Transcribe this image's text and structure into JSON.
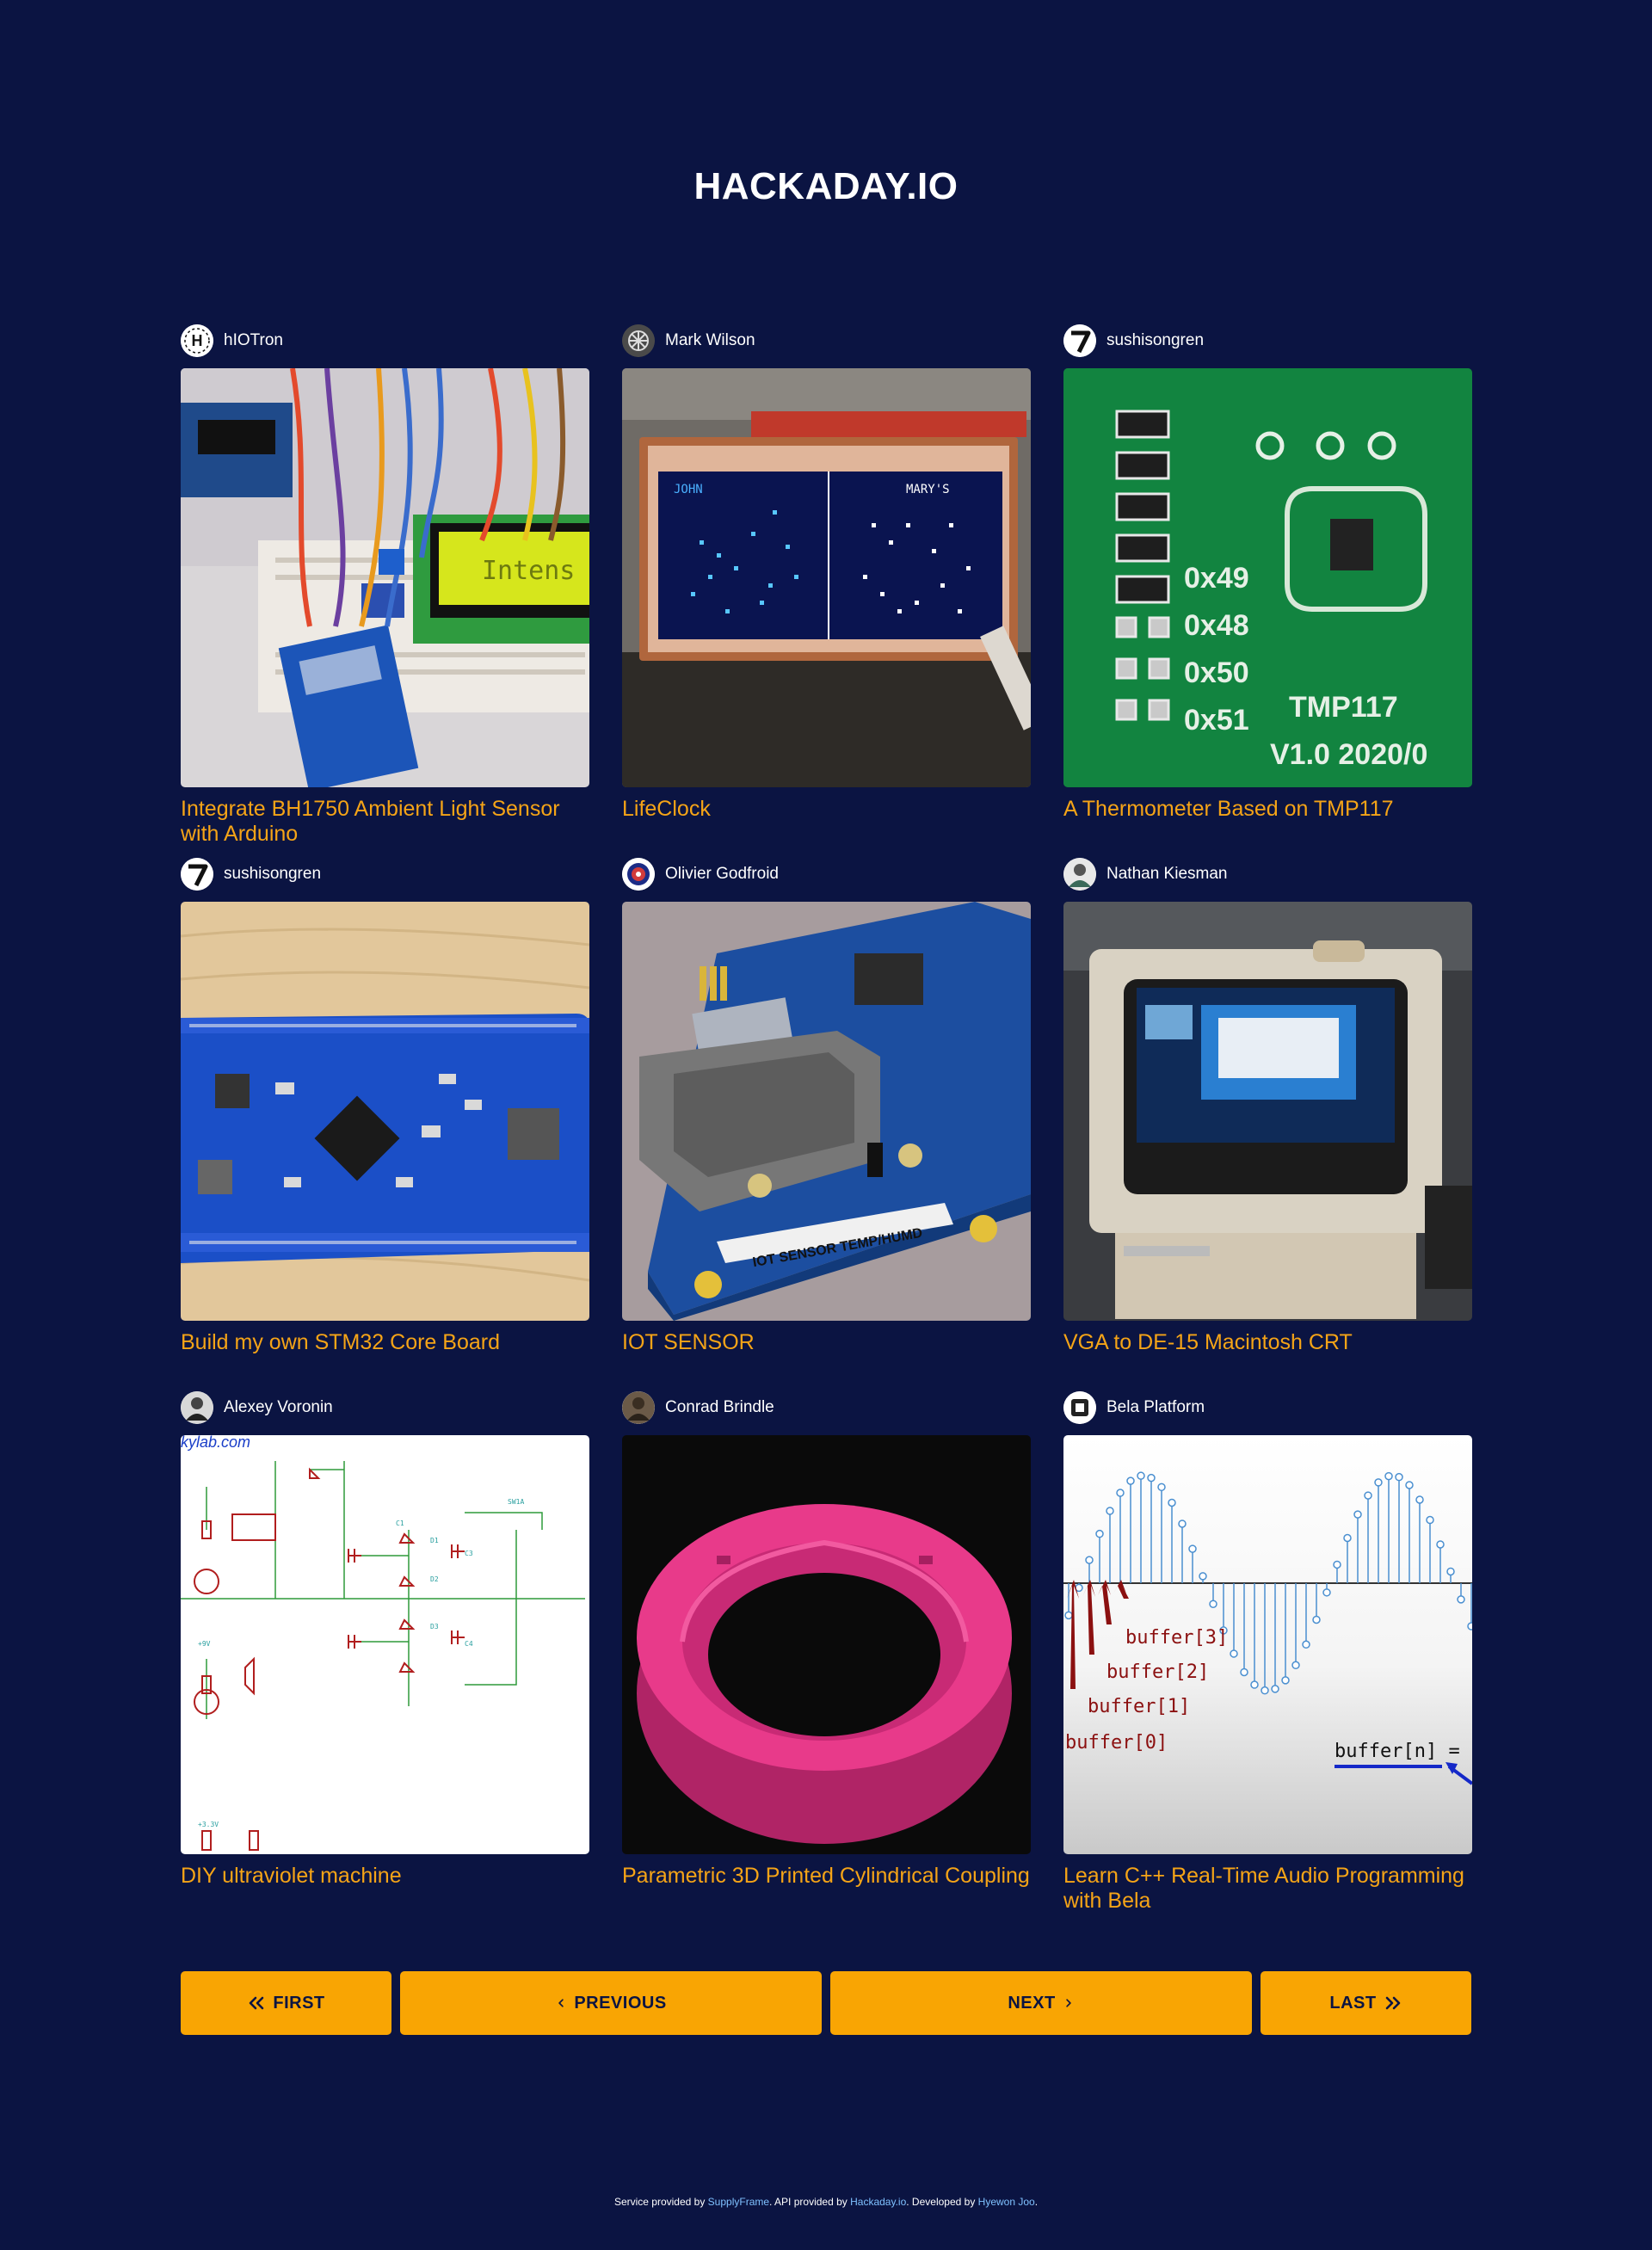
{
  "site": {
    "title": "HACKADAY.IO"
  },
  "projects": [
    {
      "author": "hIOTron",
      "title": "Integrate BH1750 Ambient Light Sensor with Arduino",
      "avatar_icon": "h-logo-avatar-icon"
    },
    {
      "author": "Mark Wilson",
      "title": "LifeClock",
      "avatar_icon": "gear-avatar-icon"
    },
    {
      "author": "sushisongren",
      "title": "A Thermometer Based on TMP117",
      "avatar_icon": "seven-avatar-icon"
    },
    {
      "author": "sushisongren",
      "title": "Build my own STM32 Core Board",
      "avatar_icon": "seven-avatar-icon"
    },
    {
      "author": "Olivier Godfroid",
      "title": "IOT SENSOR",
      "avatar_icon": "badge-avatar-icon"
    },
    {
      "author": "Nathan Kiesman",
      "title": "VGA to DE-15 Macintosh CRT",
      "avatar_icon": "person-avatar-icon"
    },
    {
      "author": "Alexey Voronin",
      "title": "DIY ultraviolet machine",
      "avatar_icon": "person-avatar-icon"
    },
    {
      "author": "Conrad Brindle",
      "title": "Parametric 3D Printed Cylindrical Coupling",
      "avatar_icon": "person-avatar-icon"
    },
    {
      "author": "Bela Platform",
      "title": "Learn C++ Real-Time Audio Programming with Bela",
      "avatar_icon": "bela-avatar-icon"
    }
  ],
  "thumb_text": {
    "lcd": "Intens",
    "clock_left": "JOHN",
    "clock_right": "MARY'S",
    "tmp_model": "TMP117",
    "tmp_version": "V1.0 2020/0",
    "tmp_addr": [
      "0x48",
      "0x49",
      "0x50",
      "0x51"
    ],
    "iot_label": "IOT SENSOR TEMP/HUMD",
    "schematic_url": "kylab.com",
    "buffers": [
      "buffer[3]",
      "buffer[2]",
      "buffer[1]",
      "buffer[0]"
    ],
    "buffer_n": "buffer[n] ="
  },
  "pagination": {
    "first": "FIRST",
    "previous": "PREVIOUS",
    "next": "NEXT",
    "last": "LAST"
  },
  "footer": {
    "t1": "Service provided by ",
    "l1": "SupplyFrame",
    "t2": ". API provided by ",
    "l2": "Hackaday.io",
    "t3": ". Developed by ",
    "l3": "Hyewon Joo",
    "t4": "."
  },
  "colors": {
    "background": "#0b1442",
    "accent": "#f9a503",
    "title_link": "#f5a417",
    "footer_link": "#7fc1ff"
  }
}
